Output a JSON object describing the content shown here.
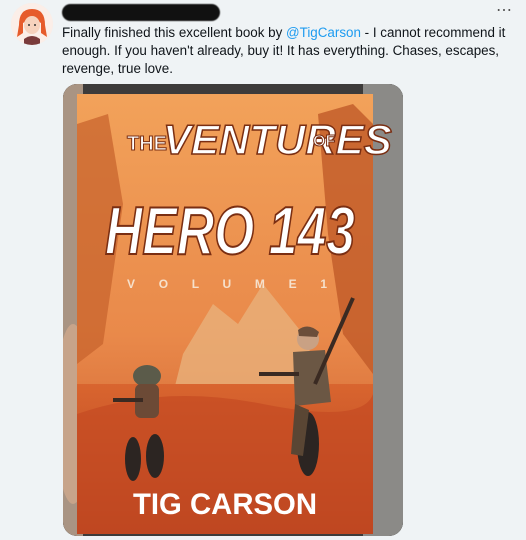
{
  "tweet": {
    "more_icon": "⋯",
    "text_before": "Finally finished this excellent book by ",
    "mention": "@TigCarson",
    "text_after": " - I cannot recommend it enough. If you haven't already, buy it! It has everything. Chases, escapes, revenge, true love."
  },
  "book": {
    "title_top_1": "THE",
    "title_top_2": "VENTURES",
    "title_top_3": "OF",
    "title_main": "HERO 143",
    "volume": "V O L U M E   1",
    "author": "TIG CARSON"
  },
  "colors": {
    "background": "#eff3f5",
    "link": "#1d9bf0",
    "cover_orange": "#e07a36"
  }
}
